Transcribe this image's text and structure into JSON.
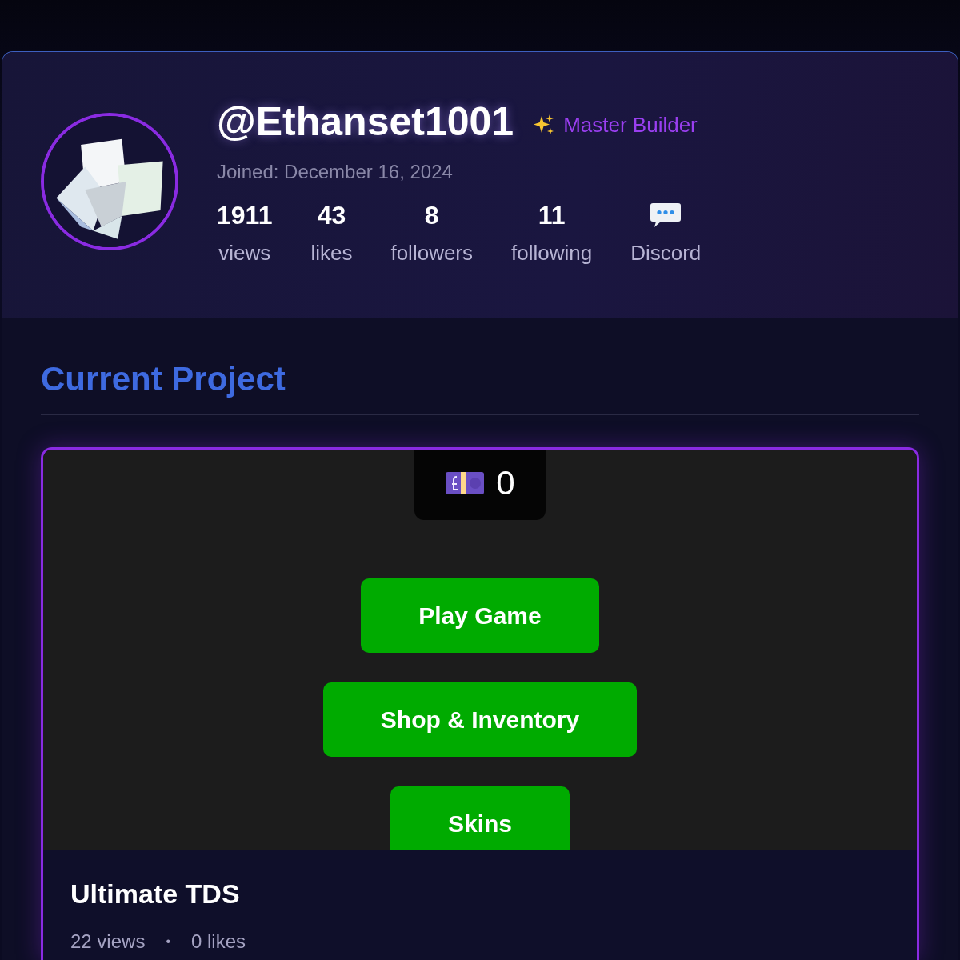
{
  "profile": {
    "username": "@Ethanset1001",
    "badge": "Master Builder",
    "joined": "Joined: December 16, 2024",
    "stats": [
      {
        "kind": "count",
        "value": "1911",
        "label": "views"
      },
      {
        "kind": "count",
        "value": "43",
        "label": "likes"
      },
      {
        "kind": "count",
        "value": "8",
        "label": "followers"
      },
      {
        "kind": "count",
        "value": "11",
        "label": "following"
      },
      {
        "kind": "link",
        "label": "Discord"
      }
    ]
  },
  "section_title": "Current Project",
  "project": {
    "preview": {
      "currency": "0",
      "buttons": [
        "Play Game",
        "Shop & Inventory",
        "Skins"
      ]
    },
    "title": "Ultimate TDS",
    "views": "22 views",
    "separator": "•",
    "likes": "0 likes"
  }
}
